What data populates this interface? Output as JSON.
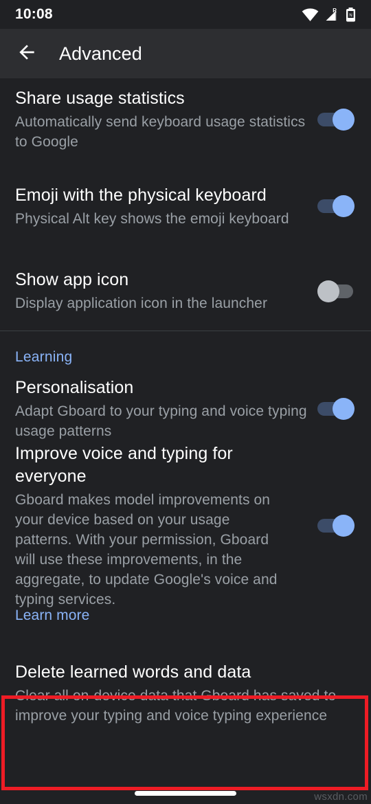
{
  "status_bar": {
    "time": "10:08",
    "icons": [
      "wifi-icon",
      "cellular-signal-roaming-icon",
      "battery-icon"
    ],
    "roaming_label": "R"
  },
  "toolbar": {
    "back_icon": "arrow-back-icon",
    "title": "Advanced"
  },
  "colors": {
    "background": "#202124",
    "toolbar": "#2d2e31",
    "accent": "#8ab4f8",
    "switch_on_track": "#3c4c68",
    "switch_off_track": "#5f6368",
    "switch_off_knob": "#bdc1c6",
    "highlight": "#ee1c25",
    "title_text": "#ffffff",
    "summary_text": "#9aa0a6",
    "divider": "#3c4043"
  },
  "preferences": [
    {
      "title": "Share usage statistics",
      "summary": "Automatically send keyboard usage statistics to Google",
      "switch": "on"
    },
    {
      "title": "Emoji with the physical keyboard",
      "summary": "Physical Alt key shows the emoji keyboard",
      "switch": "on"
    },
    {
      "title": "Show app icon",
      "summary": "Display application icon in the launcher",
      "switch": "off"
    }
  ],
  "learning_section": {
    "category_label": "Learning",
    "preferences": [
      {
        "title": "Personalisation",
        "summary": "Adapt Gboard to your typing and voice typing usage patterns",
        "switch": "on"
      },
      {
        "title": "Improve voice and typing for everyone",
        "summary": "Gboard makes model improvements on your device based on your usage patterns. With your permission, Gboard will use these improvements, in the aggregate, to update Google's voice and typing services.",
        "switch": "on"
      }
    ],
    "learn_more_label": "Learn more",
    "delete_preference": {
      "title": "Delete learned words and data",
      "summary": "Clear all on-device data that Gboard has saved to improve your typing and voice typing experience"
    }
  },
  "watermark": "wsxdn.com"
}
